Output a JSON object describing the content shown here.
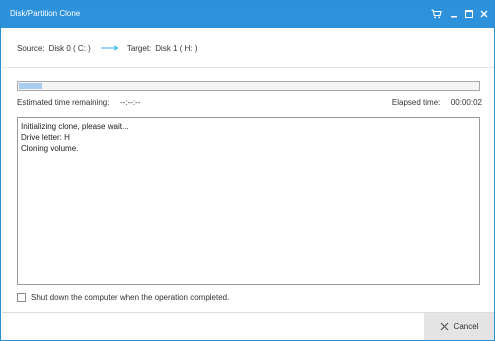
{
  "window": {
    "title": "Disk/Partition Clone",
    "titlebar_color": "#2d91db",
    "controls": [
      "cart-icon",
      "minimize-icon",
      "maximize-icon",
      "close-icon"
    ]
  },
  "clone": {
    "source_label": "Source:",
    "source_value": "Disk 0 ( C: )",
    "target_label": "Target:",
    "target_value": "Disk 1 ( H: )",
    "arrow_icon": "arrow-right-icon",
    "arrow_color": "#29b6e8"
  },
  "progress": {
    "fraction": 0.05,
    "fill_color": "#a7ccf0",
    "estimated_label": "Estimated time remaining:",
    "estimated_value": "--:--:--",
    "elapsed_label": "Elapsed time:",
    "elapsed_value": "00:00:02"
  },
  "log": {
    "lines": [
      "Initializing clone, please wait...",
      "Drive letter: H",
      "Cloning volume."
    ]
  },
  "options": {
    "shutdown_label": "Shut down the computer when the operation completed.",
    "shutdown_checked": false
  },
  "footer": {
    "cancel_label": "Cancel",
    "cancel_icon": "close-x-icon"
  }
}
